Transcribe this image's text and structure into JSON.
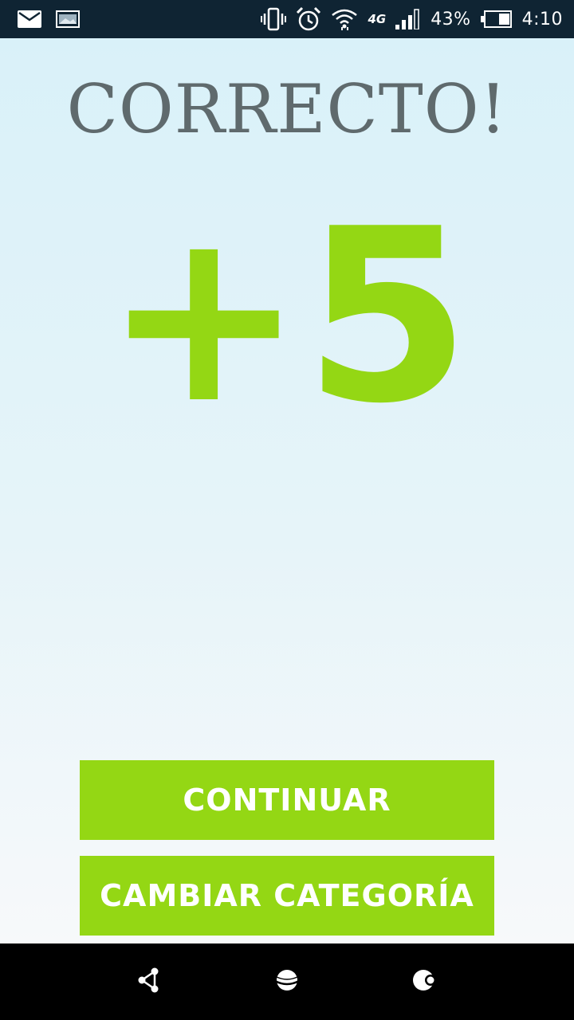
{
  "status_bar": {
    "icons": [
      "mail-icon",
      "image-icon",
      "vibrate-icon",
      "alarm-icon",
      "wifi-icon",
      "network-4g-icon",
      "signal-icon",
      "battery-icon"
    ],
    "network_type": "4G",
    "battery_percent": "43%",
    "battery_level": 0.43,
    "time": "4:10"
  },
  "result": {
    "title": "CORRECTO!",
    "score": "+5",
    "score_color": "#94d714"
  },
  "buttons": {
    "continue_label": "CONTINUAR",
    "change_category_label": "CAMBIAR CATEGORÍA",
    "color": "#94d714"
  },
  "nav_bar": {
    "icons": [
      "share-nodes-icon",
      "planet-icon",
      "moon-icon"
    ]
  }
}
